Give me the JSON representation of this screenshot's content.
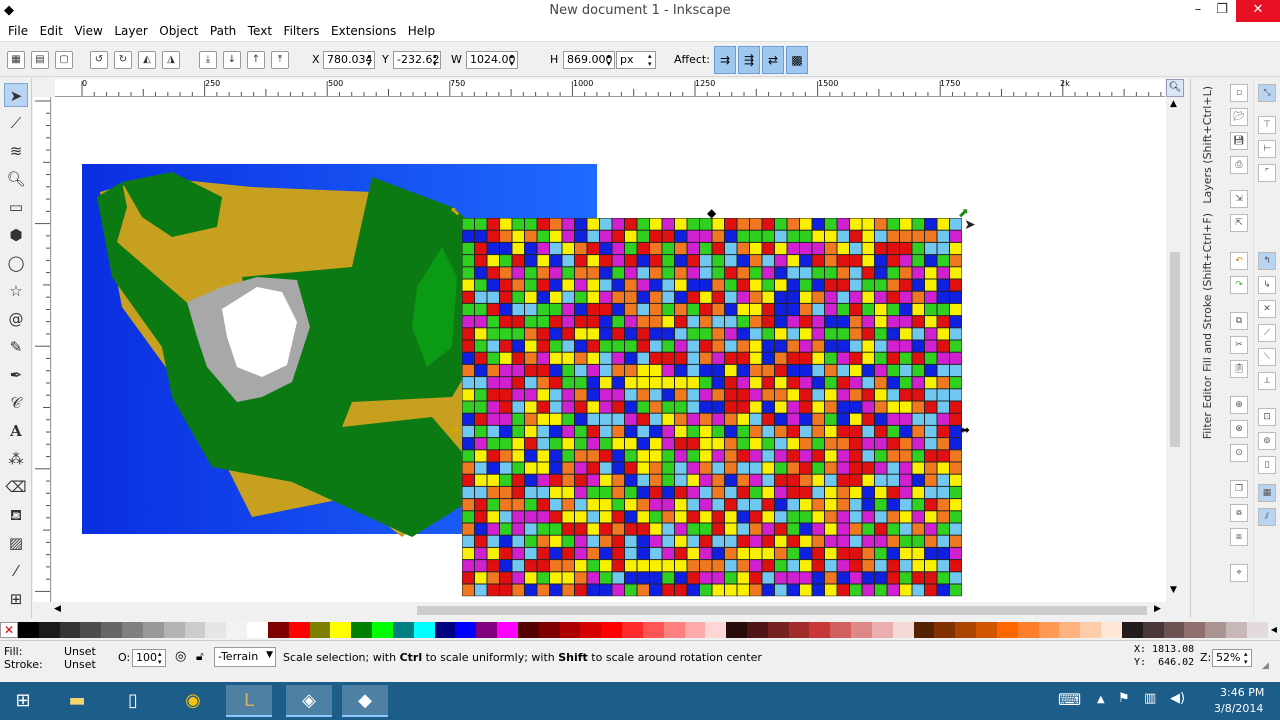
{
  "window": {
    "title": "New document 1 - Inkscape"
  },
  "menu": [
    "File",
    "Edit",
    "View",
    "Layer",
    "Object",
    "Path",
    "Text",
    "Filters",
    "Extensions",
    "Help"
  ],
  "toolbar": {
    "x_label": "X",
    "x_value": "780.034",
    "y_label": "Y",
    "y_value": "-232.62",
    "w_label": "W",
    "w_value": "1024.00",
    "h_label": "H",
    "h_value": "869.000",
    "unit": "px",
    "affect_label": "Affect:"
  },
  "ruler": {
    "h_ticks": [
      "0",
      "250",
      "500",
      "750",
      "1000",
      "1250",
      "1500",
      "1750",
      "2k"
    ]
  },
  "dock": {
    "tab_layers": "Layers (Shift+Ctrl+L)",
    "tab_fill": "Fill and Stroke (Shift+Ctrl+F)",
    "tab_filter": "Filter Editor"
  },
  "palette": [
    "#000000",
    "#1a1a1a",
    "#333333",
    "#4d4d4d",
    "#666666",
    "#808080",
    "#999999",
    "#b3b3b3",
    "#cccccc",
    "#e6e6e6",
    "#f2f2f2",
    "#ffffff",
    "#800000",
    "#ff0000",
    "#808000",
    "#ffff00",
    "#008000",
    "#00ff00",
    "#008080",
    "#00ffff",
    "#000080",
    "#0000ff",
    "#800080",
    "#ff00ff",
    "#550000",
    "#800000",
    "#aa0000",
    "#d40000",
    "#ff0000",
    "#ff2a2a",
    "#ff5555",
    "#ff8080",
    "#ffaaaa",
    "#ffd5d5",
    "#280b0b",
    "#501616",
    "#782121",
    "#a02c2c",
    "#c83737",
    "#d35f5f",
    "#de8787",
    "#e9afaf",
    "#f4d7d7",
    "#552200",
    "#803300",
    "#aa4400",
    "#d45500",
    "#ff6600",
    "#ff7f2a",
    "#ff9955",
    "#ffb380",
    "#ffccaa",
    "#ffe6d5",
    "#241c1c",
    "#483737",
    "#6c5353",
    "#916f6f",
    "#ac9393",
    "#c8b7b7",
    "#e3dbdb"
  ],
  "status": {
    "fill_label": "Fill:",
    "fill_value": "Unset",
    "stroke_label": "Stroke:",
    "stroke_value": "Unset",
    "opacity_label": "O:",
    "opacity_value": "100",
    "layer": "-Terrain",
    "message_pre": "Scale selection; with ",
    "message_key1": "Ctrl",
    "message_mid": " to scale uniformly; with ",
    "message_key2": "Shift",
    "message_post": " to scale around rotation center",
    "cursor_x": "X: 1813.08",
    "cursor_y": "Y:  646.02",
    "zoom_label": "Z:",
    "zoom_value": "52%"
  },
  "taskbar": {
    "time": "3:46 PM",
    "date": "3/8/2014"
  }
}
